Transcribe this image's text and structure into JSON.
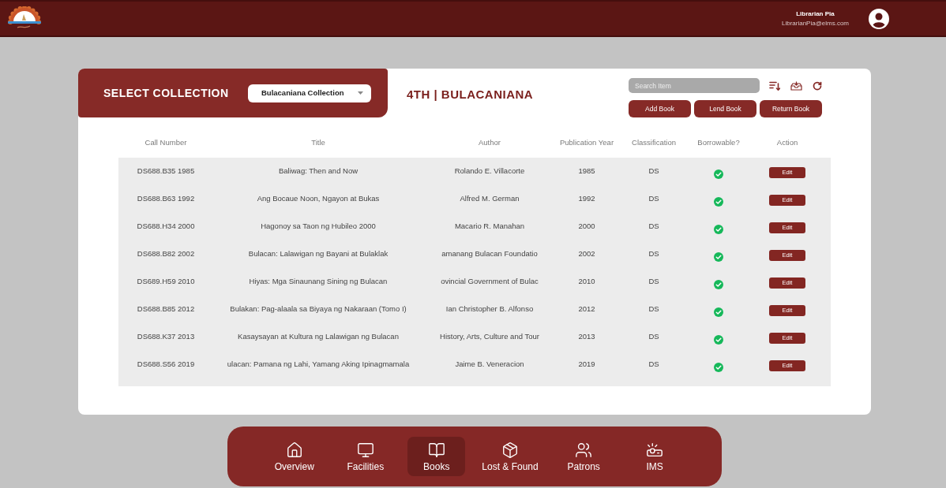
{
  "header": {
    "user_name": "Librarian Pia",
    "user_email": "LibrarianPia@elms.com"
  },
  "collection_panel": {
    "label": "SELECT COLLECTION",
    "dropdown_value": "Bulacaniana Collection"
  },
  "heading": "4TH | BULACANIANA",
  "toolbar": {
    "search": {
      "placeholder": "Search Item"
    },
    "buttons": [
      "Add Book",
      "Lend Book",
      "Return Book"
    ]
  },
  "table": {
    "columns": [
      "Call Number",
      "Title",
      "Author",
      "Publication Year",
      "Classification",
      "Borrowable?",
      "Action"
    ],
    "rows": [
      {
        "call_number": "DS688.B35 1985",
        "title": "Baliwag: Then and Now",
        "author": "Rolando E. Villacorte",
        "publication_year": "1985",
        "classification": "DS",
        "borrowable": true,
        "action": "Edit"
      },
      {
        "call_number": "DS688.B63 1992",
        "title": "Ang Bocaue Noon, Ngayon at Bukas",
        "author": "Alfred M. German",
        "publication_year": "1992",
        "classification": "DS",
        "borrowable": true,
        "action": "Edit"
      },
      {
        "call_number": "DS688.H34 2000",
        "title": "Hagonoy sa Taon ng Hubileo 2000",
        "author": "Macario R. Manahan",
        "publication_year": "2000",
        "classification": "DS",
        "borrowable": true,
        "action": "Edit"
      },
      {
        "call_number": "DS688.B82 2002",
        "title": "Bulacan: Lalawigan ng Bayani at Bulaklak",
        "author": "amanang Bulacan Foundatio",
        "publication_year": "2002",
        "classification": "DS",
        "borrowable": true,
        "action": "Edit"
      },
      {
        "call_number": "DS689.H59 2010",
        "title": "Hiyas: Mga Sinaunang Sining ng Bulacan",
        "author": "ovincial Government of Bulac",
        "publication_year": "2010",
        "classification": "DS",
        "borrowable": true,
        "action": "Edit"
      },
      {
        "call_number": "DS688.B85 2012",
        "title": "Bulakan: Pag-alaala sa Biyaya ng Nakaraan (Tomo I)",
        "author": "Ian Christopher B. Alfonso",
        "publication_year": "2012",
        "classification": "DS",
        "borrowable": true,
        "action": "Edit"
      },
      {
        "call_number": "DS688.K37 2013",
        "title": "Kasaysayan at Kultura ng Lalawigan ng Bulacan",
        "author": "History, Arts, Culture and Tour",
        "publication_year": "2013",
        "classification": "DS",
        "borrowable": true,
        "action": "Edit"
      },
      {
        "call_number": "DS688.S56 2019",
        "title": "ulacan: Pamana ng Lahi, Yamang Aking Ipinagmamala",
        "author": "Jaime B. Veneracion",
        "publication_year": "2019",
        "classification": "DS",
        "borrowable": true,
        "action": "Edit"
      }
    ]
  },
  "nav": {
    "items": [
      {
        "label": "Overview",
        "kind": "home",
        "selected": false
      },
      {
        "label": "Facilities",
        "kind": "monitor",
        "selected": false
      },
      {
        "label": "Books",
        "kind": "book",
        "selected": true
      },
      {
        "label": "Lost & Found",
        "kind": "box",
        "selected": false
      },
      {
        "label": "Patrons",
        "kind": "users",
        "selected": false
      },
      {
        "label": "IMS",
        "kind": "projector",
        "selected": false
      }
    ]
  }
}
